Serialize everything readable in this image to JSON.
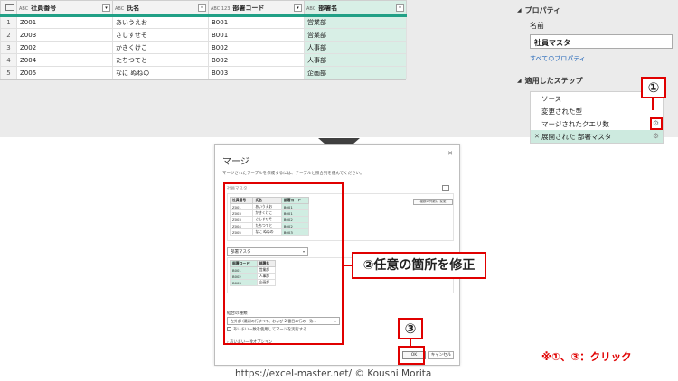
{
  "grid": {
    "headers": [
      {
        "type_icon": "ABC",
        "label": "社員番号"
      },
      {
        "type_icon": "ABC",
        "label": "氏名"
      },
      {
        "type_icon": "ABC 123",
        "label": "部署コード"
      },
      {
        "type_icon": "ABC",
        "label": "部署名"
      }
    ],
    "filter_glyph": "▾",
    "rows": [
      {
        "num": "1",
        "cells": [
          "Z001",
          "あいうえお",
          "B001",
          "営業部"
        ]
      },
      {
        "num": "2",
        "cells": [
          "Z003",
          "さしすせそ",
          "B001",
          "営業部"
        ]
      },
      {
        "num": "3",
        "cells": [
          "Z002",
          "かきくけこ",
          "B002",
          "人事部"
        ]
      },
      {
        "num": "4",
        "cells": [
          "Z004",
          "たちつてと",
          "B002",
          "人事部"
        ]
      },
      {
        "num": "5",
        "cells": [
          "Z005",
          "なに ぬねの",
          "B003",
          "企画部"
        ]
      }
    ]
  },
  "properties": {
    "header": "プロパティ",
    "name_label": "名前",
    "name_value": "社員マスタ",
    "all_properties_link": "すべてのプロパティ"
  },
  "applied_steps": {
    "header": "適用したステップ",
    "steps": [
      {
        "label": "ソース",
        "has_gear": false,
        "active": false
      },
      {
        "label": "変更された型",
        "has_gear": false,
        "active": false
      },
      {
        "label": "マージされたクエリ数",
        "has_gear": true,
        "active": false
      },
      {
        "label": "展開された 部署マスタ",
        "has_gear": true,
        "active": true
      }
    ],
    "delete_glyph": "✕",
    "gear_glyph": "⚙"
  },
  "callouts": {
    "one": "①",
    "three": "③",
    "edit_any": "②任意の箇所を修正",
    "click_note": "※①、③：クリック"
  },
  "dialog": {
    "title": "マージ",
    "close_glyph": "✕",
    "description": "マージされたテーブルを作成するには、テーブルと照合列を選んでください。",
    "table1_name": "社員マスタ",
    "hint": "複数の列数に 変更",
    "table1": {
      "headers": [
        "社員番号",
        "氏名",
        "部署コード"
      ],
      "rows": [
        [
          "Z001",
          "あいうえお",
          "B001"
        ],
        [
          "Z003",
          "かきくけこ",
          "B001"
        ],
        [
          "Z003",
          "さしすせそ",
          "B002"
        ],
        [
          "Z004",
          "たちつてと",
          "B002"
        ],
        [
          "Z005",
          "なに ぬねの",
          "B003"
        ]
      ]
    },
    "table2_select": "部署マスタ",
    "table2": {
      "headers": [
        "部署コード",
        "部署名"
      ],
      "rows": [
        [
          "B001",
          "営業部"
        ],
        [
          "B002",
          "人事部"
        ],
        [
          "B003",
          "企画部"
        ]
      ]
    },
    "join_label": "結合の種類",
    "join_value": "左外部 (最初の行すべて、および 2 番目の行の一致…",
    "fuzzy_check": "あいまい一致を使用してマージを実行する",
    "fuzzy_options": "› あいまい一致オプション",
    "ok_label": "OK",
    "cancel_label": "キャンセル"
  },
  "footer": {
    "url": "https://excel-master.net/  © Koushi Morita"
  },
  "colors": {
    "accent_red": "#e00000",
    "green_underline": "#21a086",
    "selected_cell": "#d8efe6"
  }
}
